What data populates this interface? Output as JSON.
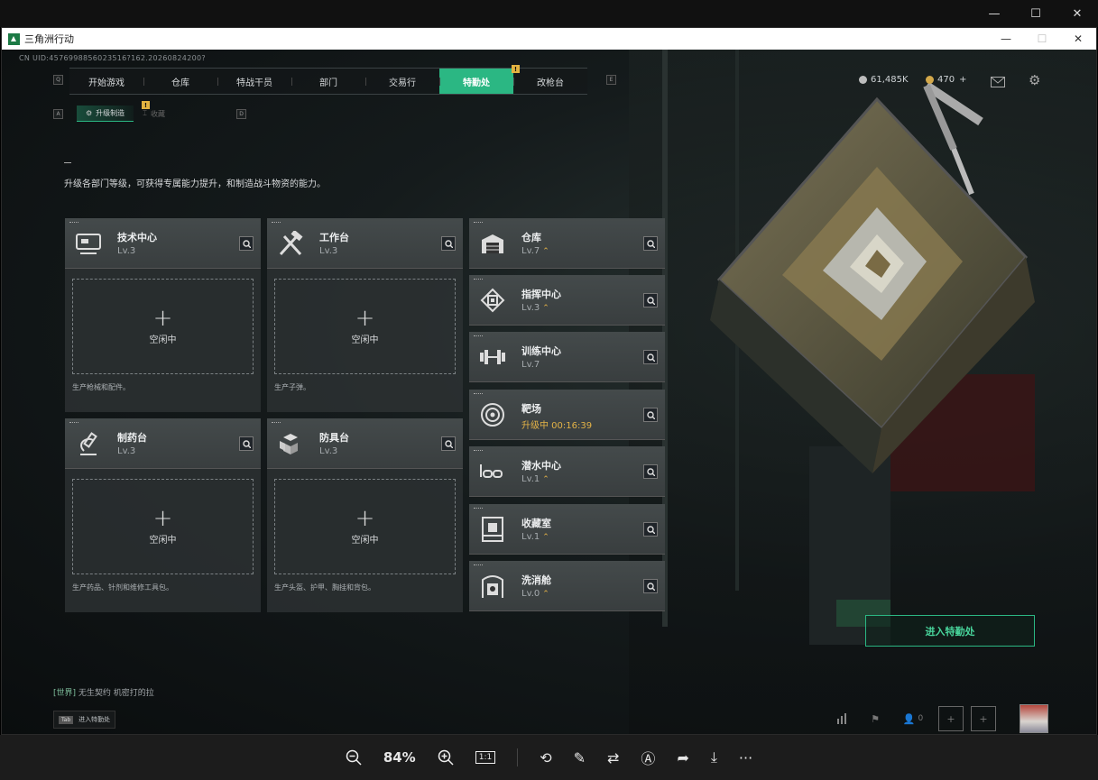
{
  "outer_window": {
    "min": "—",
    "max": "☐",
    "close": "✕"
  },
  "app_window": {
    "title": "三角洲行动",
    "min": "—",
    "max": "☐",
    "close": "✕"
  },
  "uid": "CN UID:4576998856023516?162.20260824200?",
  "nav": {
    "left_key": "Q",
    "right_key": "E",
    "tabs": [
      "开始游戏",
      "仓库",
      "特战干员",
      "部门",
      "交易行",
      "特勤处",
      "改枪台"
    ],
    "active_index": 5,
    "alert": "!"
  },
  "currency": {
    "coins": "61,485K",
    "tickets": "470",
    "tickets_add": "+"
  },
  "subtabs": {
    "left_key": "A",
    "right_key": "D",
    "upgrade": "升级制造",
    "upgrade_alert": "!",
    "collection": "收藏"
  },
  "description": "升级各部门等级，可获得专属能力提升，和制造战斗物资的能力。",
  "production": [
    {
      "name": "技术中心",
      "level": "Lv.3",
      "icon": "tech-center-icon",
      "slot_plus": "+",
      "slot_status": "空闲中",
      "footer": "生产枪械和配件。"
    },
    {
      "name": "工作台",
      "level": "Lv.3",
      "icon": "workbench-icon",
      "slot_plus": "+",
      "slot_status": "空闲中",
      "footer": "生产子弹。"
    },
    {
      "name": "制药台",
      "level": "Lv.3",
      "icon": "pharmacy-icon",
      "slot_plus": "+",
      "slot_status": "空闲中",
      "footer": "生产药品、针剂和维修工具包。"
    },
    {
      "name": "防具台",
      "level": "Lv.3",
      "icon": "armor-bench-icon",
      "slot_plus": "+",
      "slot_status": "空闲中",
      "footer": "生产头盔、护甲、胸挂和背包。"
    }
  ],
  "facilities": [
    {
      "name": "仓库",
      "level": "Lv.7",
      "icon": "warehouse-icon",
      "upgradable": true
    },
    {
      "name": "指挥中心",
      "level": "Lv.3",
      "icon": "command-center-icon",
      "upgradable": true
    },
    {
      "name": "训练中心",
      "level": "Lv.7",
      "icon": "training-center-icon",
      "upgradable": false
    },
    {
      "name": "靶场",
      "level": "升级中 00:16:39",
      "icon": "shooting-range-icon",
      "upgradable": false,
      "upgrading": true
    },
    {
      "name": "潜水中心",
      "level": "Lv.1",
      "icon": "diving-center-icon",
      "upgradable": true
    },
    {
      "name": "收藏室",
      "level": "Lv.1",
      "icon": "collection-room-icon",
      "upgradable": true
    },
    {
      "name": "洗消舱",
      "level": "Lv.0",
      "icon": "decontamination-icon",
      "upgradable": true
    }
  ],
  "enter_button": "进入特勤处",
  "chat": {
    "channel": "[世界]",
    "message": "无生契约 机密打的拉"
  },
  "tab_hint": {
    "key": "Tab",
    "label": "进入特勤处"
  },
  "bottom_bar": {
    "friends_count": "0"
  },
  "viewer": {
    "zoom": "84%",
    "ratio": "1:1",
    "more": "···"
  },
  "colors": {
    "accent": "#2bb783",
    "alert": "#e2b340",
    "panel": "#3d4243"
  }
}
